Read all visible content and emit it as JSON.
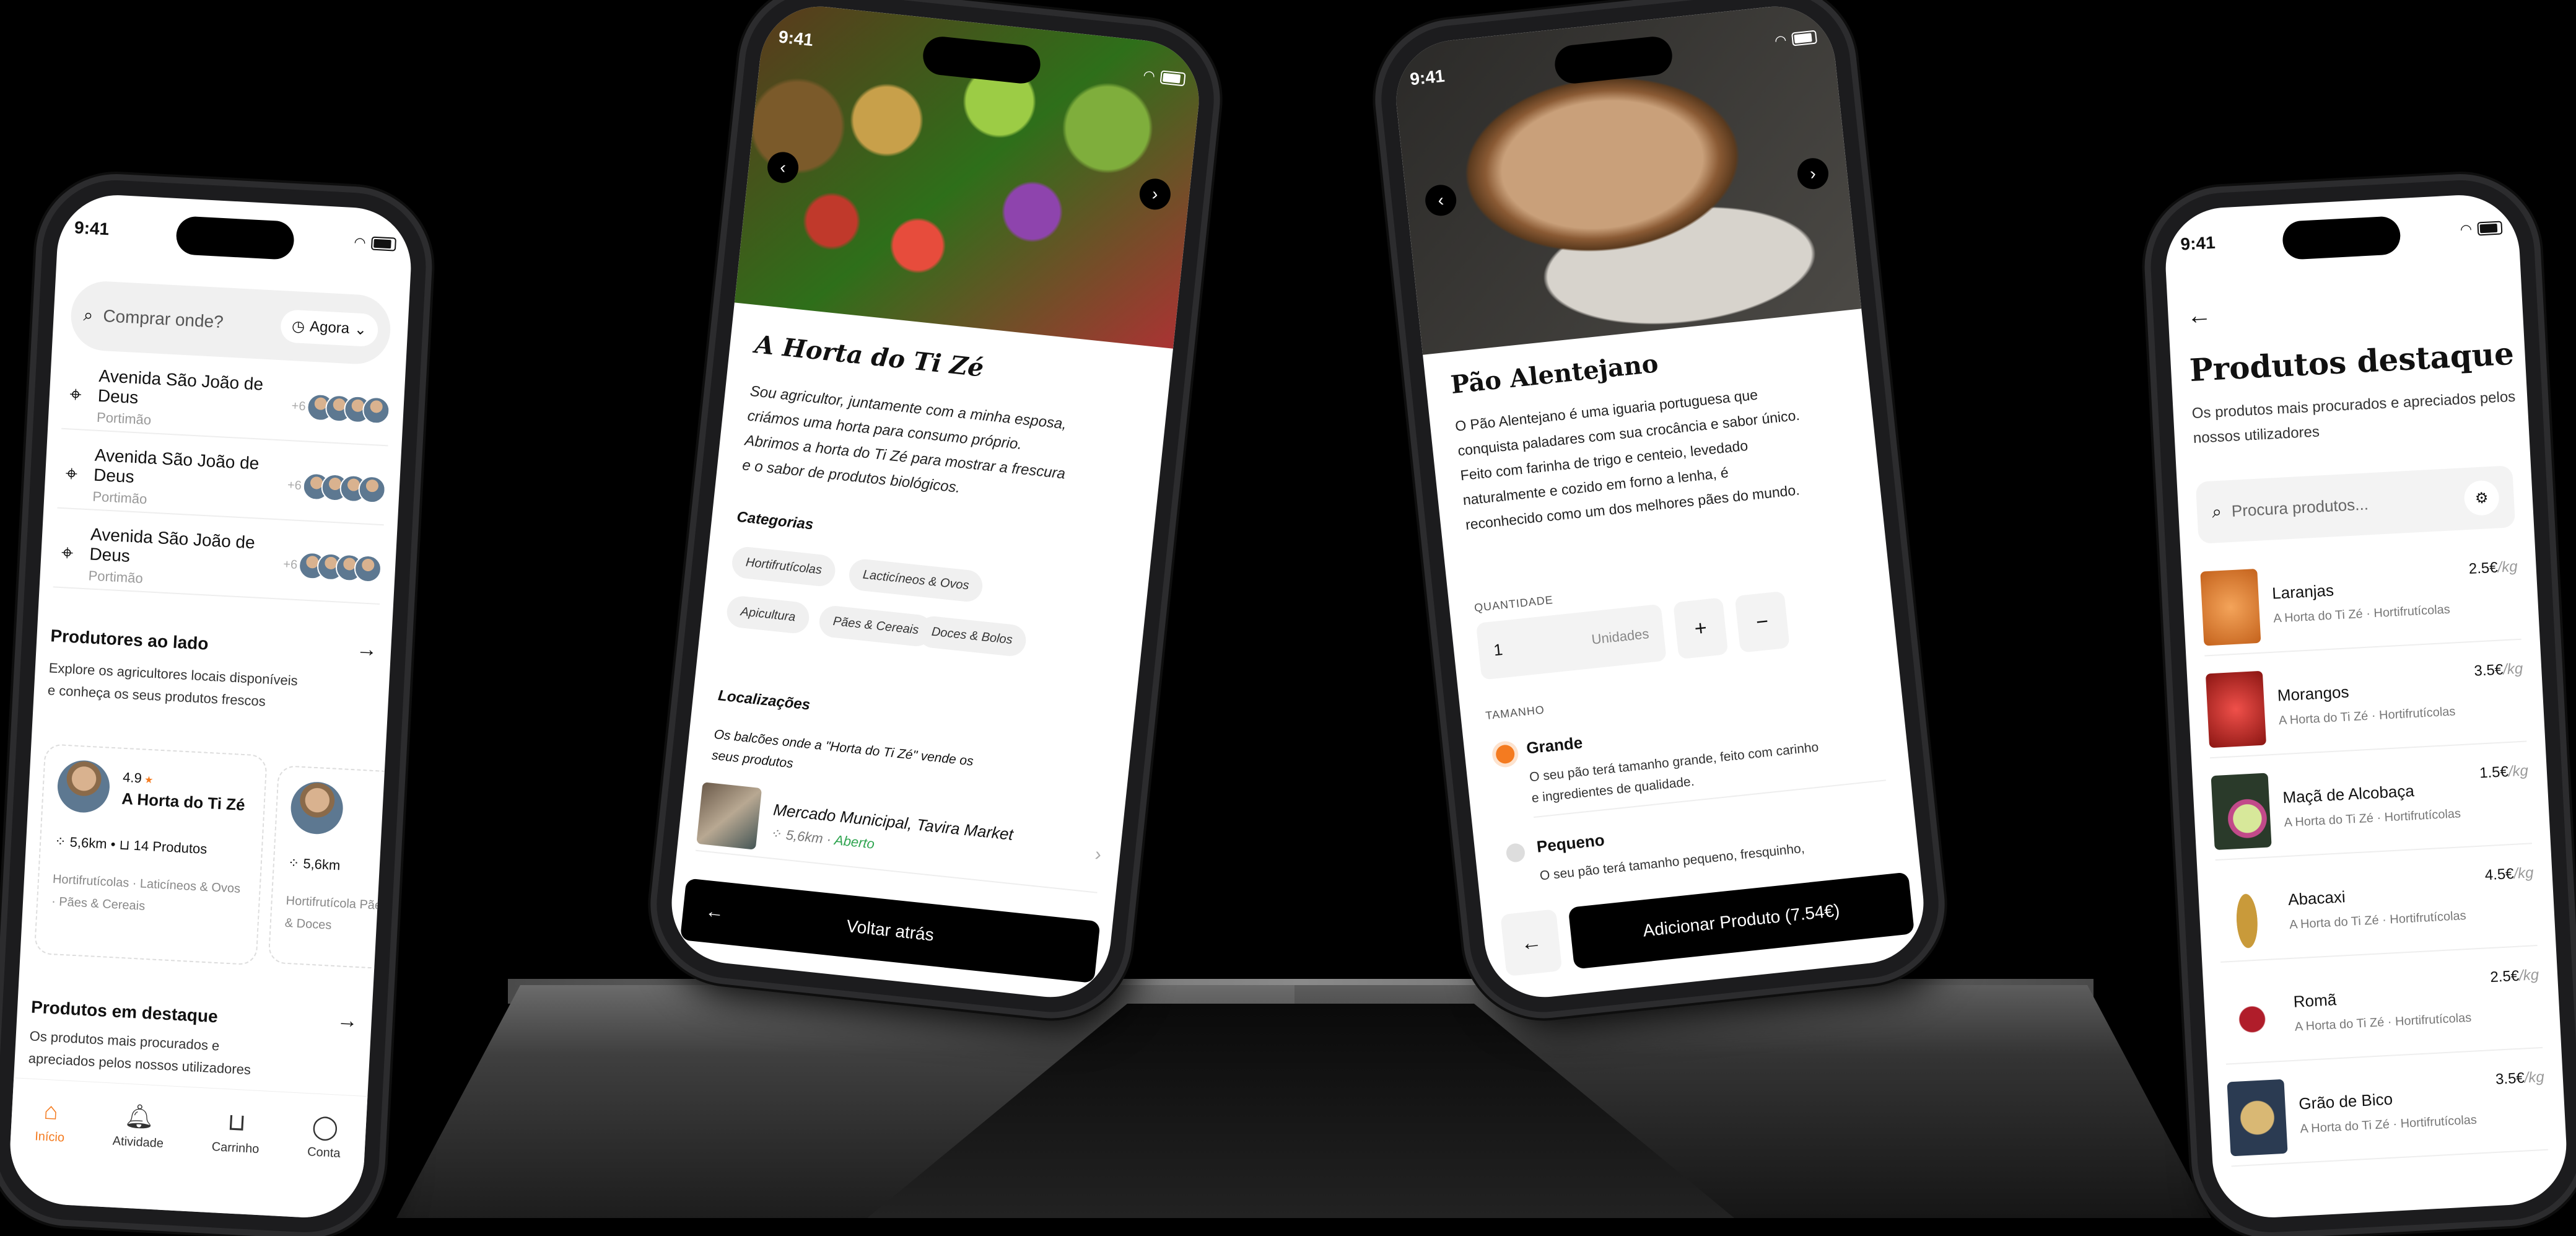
{
  "status_time": "9:41",
  "accent": "#f47b20",
  "home": {
    "search_placeholder": "Comprar onde?",
    "time_pill": "Agora",
    "addresses": [
      {
        "street": "Avenida São João de Deus",
        "city": "Portimão",
        "extra": "+6"
      },
      {
        "street": "Avenida São João de Deus",
        "city": "Portimão",
        "extra": "+6"
      },
      {
        "street": "Avenida São João de Deus",
        "city": "Portimão",
        "extra": "+6"
      }
    ],
    "producers_title": "Produtores ao lado",
    "producers_desc": "Explore os agricultores locais disponíveis e conheça os seus produtos frescos",
    "producer_card": {
      "rating": "4.9",
      "name": "A Horta do Ti Zé",
      "distance": "5,6km",
      "products": "14 Produtos",
      "tags": "Hortifrutícolas · Laticíneos & Ovos · Pães & Cereais"
    },
    "producer_card_2": {
      "distance": "5,6km",
      "tags": "Hortifrutícola Pães & Doces"
    },
    "featured_title": "Produtos em destaque",
    "featured_desc": "Os produtos mais procurados e apreciados pelos nossos utilizadores",
    "nav": [
      {
        "label": "Início",
        "icon": "home-icon"
      },
      {
        "label": "Atividade",
        "icon": "bell-icon"
      },
      {
        "label": "Carrinho",
        "icon": "bag-icon"
      },
      {
        "label": "Conta",
        "icon": "user-icon"
      }
    ]
  },
  "producer": {
    "title": "A Horta do Ti Zé",
    "description": "Sou agricultor, juntamente com a minha esposa, criámos uma horta para consumo próprio. Abrimos a horta do Ti Zé para mostrar a frescura e o sabor de produtos biológicos.",
    "categories_title": "Categorias",
    "categories": [
      "Hortifrutícolas",
      "Lacticíneos & Ovos",
      "Apicultura",
      "Pães & Cereais",
      "Doces & Bolos"
    ],
    "locations_title": "Localizações",
    "locations_desc": "Os balcões onde a \"Horta do Ti Zé\" vende os seus produtos",
    "location": {
      "name": "Mercado Municipal, Tavira Market",
      "distance": "5,6km",
      "status": "Aberto"
    },
    "back_button": "Voltar atrás"
  },
  "product": {
    "title": "Pão Alentejano",
    "description": "O Pão Alentejano é uma iguaria portuguesa que conquista paladares com sua crocância e sabor único. Feito com farinha de trigo e centeio, levedado naturalmente e cozido em forno a lenha, é reconhecido como um dos melhores pães do mundo.",
    "qty_label": "QUANTIDADE",
    "qty_value": "1",
    "qty_unit": "Unidades",
    "size_label": "TAMANHO",
    "options": [
      {
        "name": "Grande",
        "desc": "O seu pão terá tamanho grande, feito com carinho e ingredientes de qualidade.",
        "selected": true
      },
      {
        "name": "Pequeno",
        "desc": "O seu pão terá tamanho pequeno, fresquinho,",
        "selected": false
      }
    ],
    "add_button": "Adicionar Produto (7.54€)"
  },
  "featured": {
    "title": "Produtos destaque",
    "description": "Os produtos mais procurados e apreciados pelos nossos utilizadores",
    "search_placeholder": "Procura produtos...",
    "items": [
      {
        "name": "Laranjas",
        "sub": "A Horta do Ti Zé · Hortifrutícolas",
        "price": "2.5€",
        "unit": "/kg",
        "color": "#e8893a"
      },
      {
        "name": "Morangos",
        "sub": "A Horta do Ti Zé · Hortifrutícolas",
        "price": "3.5€",
        "unit": "/kg",
        "color": "#d3302b"
      },
      {
        "name": "Maçã de Alcobaça",
        "sub": "A Horta do Ti Zé · Hortifrutícolas",
        "price": "1.5€",
        "unit": "/kg",
        "color": "#8fbf4a"
      },
      {
        "name": "Abacaxi",
        "sub": "A Horta do Ti Zé · Hortifrutícolas",
        "price": "4.5€",
        "unit": "/kg",
        "color": "#c99a3a"
      },
      {
        "name": "Romã",
        "sub": "A Horta do Ti Zé · Hortifrutícolas",
        "price": "2.5€",
        "unit": "/kg",
        "color": "#b01d2a"
      },
      {
        "name": "Grão de Bico",
        "sub": "A Horta do Ti Zé · Hortifrutícolas",
        "price": "3.5€",
        "unit": "/kg",
        "color": "#c9a25e"
      }
    ]
  }
}
